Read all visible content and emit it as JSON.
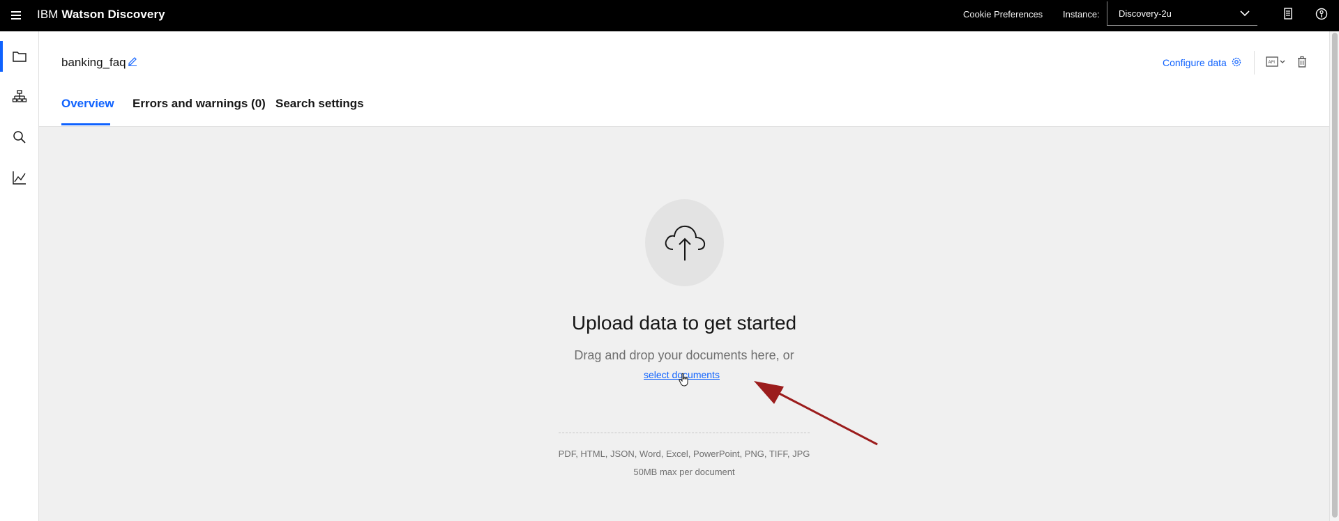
{
  "topbar": {
    "brand_ibm": "IBM",
    "brand_product": "Watson Discovery",
    "cookie_label": "Cookie Preferences",
    "instance_label": "Instance:",
    "instance_value": "Discovery-2u"
  },
  "rail": {
    "items": [
      {
        "icon": "folder-icon",
        "active": true
      },
      {
        "icon": "hierarchy-icon",
        "active": false
      },
      {
        "icon": "search-icon",
        "active": false
      },
      {
        "icon": "chart-line-icon",
        "active": false
      }
    ]
  },
  "header": {
    "collection_name": "banking_faq",
    "tabs": [
      {
        "label": "Overview",
        "active": true
      },
      {
        "label": "Errors and warnings (0)",
        "active": false
      },
      {
        "label": "Search settings",
        "active": false
      }
    ],
    "configure_label": "Configure data"
  },
  "main": {
    "title": "Upload data to get started",
    "subtitle": "Drag and drop your documents here, or",
    "select_link": "select documents",
    "formats": "PDF, HTML, JSON, Word, Excel, PowerPoint, PNG, TIFF, JPG",
    "max_size": "50MB max per document"
  },
  "colors": {
    "accent": "#0f62fe",
    "annotation_arrow": "#9b1c1c",
    "topbar": "#000000",
    "main_bg": "#f0f0f0"
  }
}
